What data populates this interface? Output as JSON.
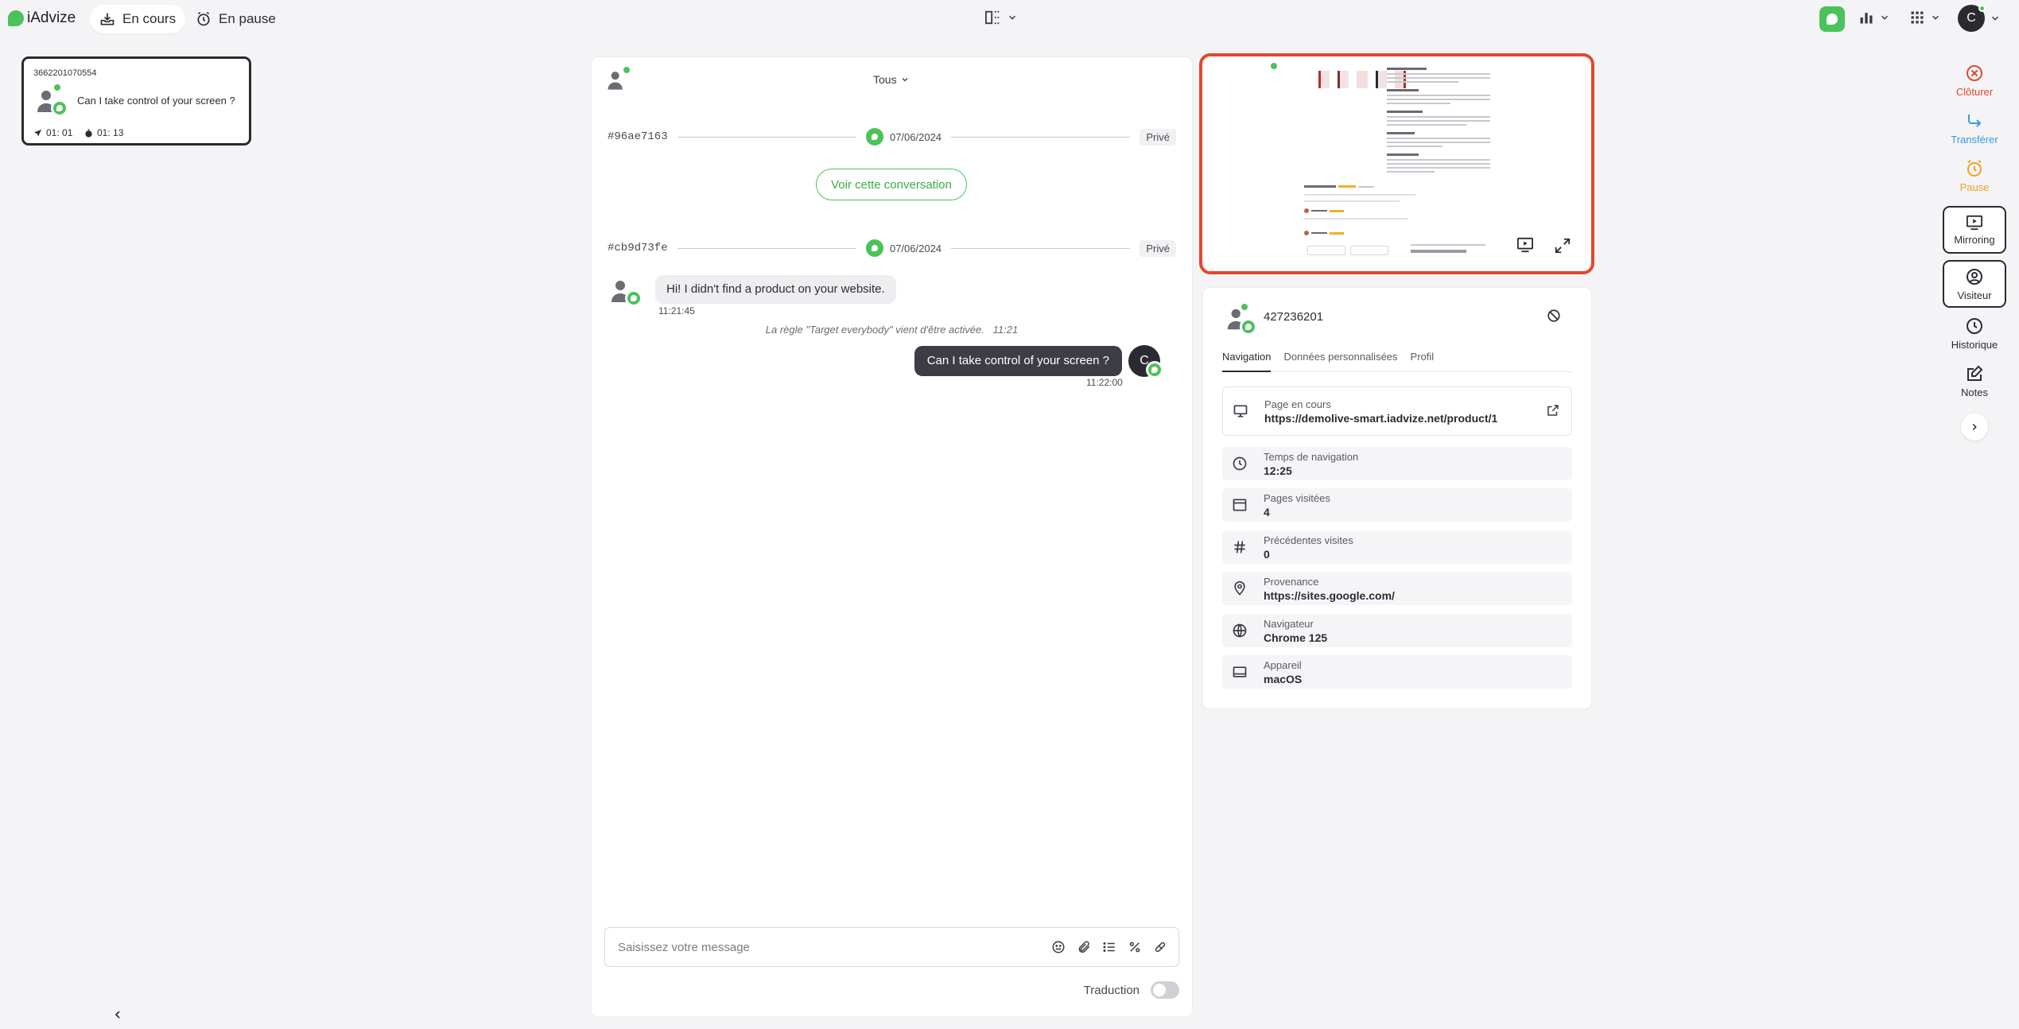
{
  "app": {
    "logo_text": "iAdvize"
  },
  "header": {
    "tab_en_cours": "En cours",
    "tab_en_pause": "En pause",
    "user_initial": "C"
  },
  "conversation_card": {
    "id": "3662201070554",
    "message": "Can I take control of your screen ?",
    "wait_time": "01: 01",
    "duration": "01: 13"
  },
  "chat": {
    "filter": "Tous",
    "threads": [
      {
        "hash": "#96ae7163",
        "date": "07/06/2024",
        "badge": "Privé"
      },
      {
        "hash": "#cb9d73fe",
        "date": "07/06/2024",
        "badge": "Privé"
      }
    ],
    "view_button": "Voir cette conversation",
    "messages": [
      {
        "from": "visitor",
        "text": "Hi! I didn't find a product on your website.",
        "time": "11:21:45"
      },
      {
        "from": "agent",
        "text": "Can I take control of your screen ?",
        "time": "11:22:00",
        "initial": "C"
      }
    ],
    "system_message": "La règle \"Target everybody\" vient d'être activée.",
    "system_time": "11:21",
    "composer_placeholder": "Saisissez votre message",
    "translation_label": "Traduction"
  },
  "visitor": {
    "id": "427236201",
    "tabs": [
      "Navigation",
      "Données personnalisées",
      "Profil"
    ],
    "rows": [
      {
        "label": "Page en cours",
        "value": "https://demolive-smart.iadvize.net/product/1",
        "icon": "monitor-icon"
      },
      {
        "label": "Temps de navigation",
        "value": "12:25",
        "icon": "clock-icon"
      },
      {
        "label": "Pages visitées",
        "value": "4",
        "icon": "browser-window-icon"
      },
      {
        "label": "Précédentes visites",
        "value": "0",
        "icon": "hash-icon"
      },
      {
        "label": "Provenance",
        "value": "https://sites.google.com/",
        "icon": "location-pin-icon"
      },
      {
        "label": "Navigateur",
        "value": "Chrome 125",
        "icon": "globe-icon"
      },
      {
        "label": "Appareil",
        "value": "macOS",
        "icon": "laptop-icon"
      }
    ]
  },
  "actions": {
    "close": "Clôturer",
    "transfer": "Transférer",
    "pause": "Pause",
    "mirroring": "Mirroring",
    "visitor": "Visiteur",
    "history": "Historique",
    "notes": "Notes"
  },
  "colors": {
    "accent_green": "#4cc25a",
    "close_red": "#e4462e",
    "transfer_blue": "#3a9bdc",
    "pause_orange": "#f0a020"
  }
}
